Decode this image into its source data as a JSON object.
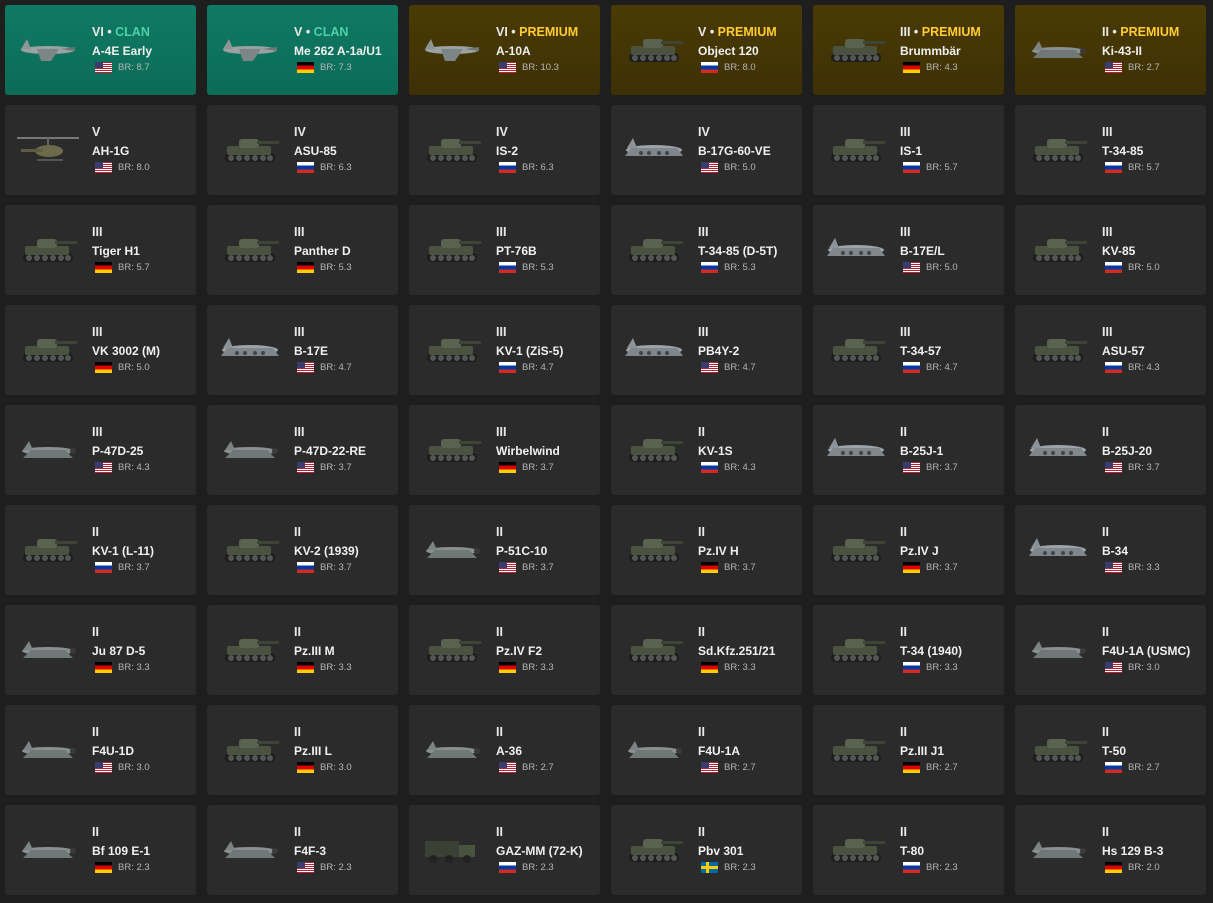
{
  "br_prefix": "BR: ",
  "tag_separator": " • ",
  "cards": [
    {
      "tier": "VI",
      "tag": "CLAN",
      "style": "clan",
      "name": "A-4E Early",
      "nation": "usa",
      "br": "8.7",
      "kind": "jet"
    },
    {
      "tier": "V",
      "tag": "CLAN",
      "style": "clan",
      "name": "Me 262 A-1a/U1",
      "nation": "ger",
      "br": "7.3",
      "kind": "jet"
    },
    {
      "tier": "VI",
      "tag": "PREMIUM",
      "style": "premium",
      "name": "A-10A",
      "nation": "usa",
      "br": "10.3",
      "kind": "jet"
    },
    {
      "tier": "V",
      "tag": "PREMIUM",
      "style": "premium",
      "name": "Object 120",
      "nation": "ussr",
      "br": "8.0",
      "kind": "tank"
    },
    {
      "tier": "III",
      "tag": "PREMIUM",
      "style": "premium",
      "name": "Brummbär",
      "nation": "ger",
      "br": "4.3",
      "kind": "tank"
    },
    {
      "tier": "II",
      "tag": "PREMIUM",
      "style": "premium",
      "name": "Ki-43-II",
      "nation": "usa",
      "br": "2.7",
      "kind": "plane"
    },
    {
      "tier": "V",
      "tag": "",
      "style": "normal",
      "name": "AH-1G",
      "nation": "usa",
      "br": "8.0",
      "kind": "heli"
    },
    {
      "tier": "IV",
      "tag": "",
      "style": "normal",
      "name": "ASU-85",
      "nation": "ussr",
      "br": "6.3",
      "kind": "tank"
    },
    {
      "tier": "IV",
      "tag": "",
      "style": "normal",
      "name": "IS-2",
      "nation": "ussr",
      "br": "6.3",
      "kind": "tank"
    },
    {
      "tier": "IV",
      "tag": "",
      "style": "normal",
      "name": "B-17G-60-VE",
      "nation": "usa",
      "br": "5.0",
      "kind": "bomber"
    },
    {
      "tier": "III",
      "tag": "",
      "style": "normal",
      "name": "IS-1",
      "nation": "ussr",
      "br": "5.7",
      "kind": "tank"
    },
    {
      "tier": "III",
      "tag": "",
      "style": "normal",
      "name": "T-34-85",
      "nation": "ussr",
      "br": "5.7",
      "kind": "tank"
    },
    {
      "tier": "III",
      "tag": "",
      "style": "normal",
      "name": "Tiger H1",
      "nation": "ger",
      "br": "5.7",
      "kind": "tank"
    },
    {
      "tier": "III",
      "tag": "",
      "style": "normal",
      "name": "Panther D",
      "nation": "ger",
      "br": "5.3",
      "kind": "tank"
    },
    {
      "tier": "III",
      "tag": "",
      "style": "normal",
      "name": "PT-76B",
      "nation": "ussr",
      "br": "5.3",
      "kind": "tank"
    },
    {
      "tier": "III",
      "tag": "",
      "style": "normal",
      "name": "T-34-85 (D-5T)",
      "nation": "ussr",
      "br": "5.3",
      "kind": "tank"
    },
    {
      "tier": "III",
      "tag": "",
      "style": "normal",
      "name": "B-17E/L",
      "nation": "usa",
      "br": "5.0",
      "kind": "bomber"
    },
    {
      "tier": "III",
      "tag": "",
      "style": "normal",
      "name": "KV-85",
      "nation": "ussr",
      "br": "5.0",
      "kind": "tank"
    },
    {
      "tier": "III",
      "tag": "",
      "style": "normal",
      "name": "VK 3002 (M)",
      "nation": "ger",
      "br": "5.0",
      "kind": "tank"
    },
    {
      "tier": "III",
      "tag": "",
      "style": "normal",
      "name": "B-17E",
      "nation": "usa",
      "br": "4.7",
      "kind": "bomber"
    },
    {
      "tier": "III",
      "tag": "",
      "style": "normal",
      "name": "KV-1 (ZiS-5)",
      "nation": "ussr",
      "br": "4.7",
      "kind": "tank"
    },
    {
      "tier": "III",
      "tag": "",
      "style": "normal",
      "name": "PB4Y-2",
      "nation": "usa",
      "br": "4.7",
      "kind": "bomber"
    },
    {
      "tier": "III",
      "tag": "",
      "style": "normal",
      "name": "T-34-57",
      "nation": "ussr",
      "br": "4.7",
      "kind": "tank"
    },
    {
      "tier": "III",
      "tag": "",
      "style": "normal",
      "name": "ASU-57",
      "nation": "ussr",
      "br": "4.3",
      "kind": "tank"
    },
    {
      "tier": "III",
      "tag": "",
      "style": "normal",
      "name": "P-47D-25",
      "nation": "usa",
      "br": "4.3",
      "kind": "plane"
    },
    {
      "tier": "III",
      "tag": "",
      "style": "normal",
      "name": "P-47D-22-RE",
      "nation": "usa",
      "br": "3.7",
      "kind": "plane"
    },
    {
      "tier": "III",
      "tag": "",
      "style": "normal",
      "name": "Wirbelwind",
      "nation": "ger",
      "br": "3.7",
      "kind": "tank"
    },
    {
      "tier": "II",
      "tag": "",
      "style": "normal",
      "name": "KV-1S",
      "nation": "ussr",
      "br": "4.3",
      "kind": "tank"
    },
    {
      "tier": "II",
      "tag": "",
      "style": "normal",
      "name": "B-25J-1",
      "nation": "usa",
      "br": "3.7",
      "kind": "bomber"
    },
    {
      "tier": "II",
      "tag": "",
      "style": "normal",
      "name": "B-25J-20",
      "nation": "usa",
      "br": "3.7",
      "kind": "bomber"
    },
    {
      "tier": "II",
      "tag": "",
      "style": "normal",
      "name": "KV-1 (L-11)",
      "nation": "ussr",
      "br": "3.7",
      "kind": "tank"
    },
    {
      "tier": "II",
      "tag": "",
      "style": "normal",
      "name": "KV-2 (1939)",
      "nation": "ussr",
      "br": "3.7",
      "kind": "tank"
    },
    {
      "tier": "II",
      "tag": "",
      "style": "normal",
      "name": "P-51C-10",
      "nation": "usa",
      "br": "3.7",
      "kind": "plane"
    },
    {
      "tier": "II",
      "tag": "",
      "style": "normal",
      "name": "Pz.IV H",
      "nation": "ger",
      "br": "3.7",
      "kind": "tank"
    },
    {
      "tier": "II",
      "tag": "",
      "style": "normal",
      "name": "Pz.IV J",
      "nation": "ger",
      "br": "3.7",
      "kind": "tank"
    },
    {
      "tier": "II",
      "tag": "",
      "style": "normal",
      "name": "B-34",
      "nation": "usa",
      "br": "3.3",
      "kind": "bomber"
    },
    {
      "tier": "II",
      "tag": "",
      "style": "normal",
      "name": "Ju 87 D-5",
      "nation": "ger",
      "br": "3.3",
      "kind": "plane"
    },
    {
      "tier": "II",
      "tag": "",
      "style": "normal",
      "name": "Pz.III M",
      "nation": "ger",
      "br": "3.3",
      "kind": "tank"
    },
    {
      "tier": "II",
      "tag": "",
      "style": "normal",
      "name": "Pz.IV F2",
      "nation": "ger",
      "br": "3.3",
      "kind": "tank"
    },
    {
      "tier": "II",
      "tag": "",
      "style": "normal",
      "name": "Sd.Kfz.251/21",
      "nation": "ger",
      "br": "3.3",
      "kind": "tank"
    },
    {
      "tier": "II",
      "tag": "",
      "style": "normal",
      "name": "T-34 (1940)",
      "nation": "ussr",
      "br": "3.3",
      "kind": "tank"
    },
    {
      "tier": "II",
      "tag": "",
      "style": "normal",
      "name": "F4U-1A (USMC)",
      "nation": "usa",
      "br": "3.0",
      "kind": "plane"
    },
    {
      "tier": "II",
      "tag": "",
      "style": "normal",
      "name": "F4U-1D",
      "nation": "usa",
      "br": "3.0",
      "kind": "plane"
    },
    {
      "tier": "II",
      "tag": "",
      "style": "normal",
      "name": "Pz.III L",
      "nation": "ger",
      "br": "3.0",
      "kind": "tank"
    },
    {
      "tier": "II",
      "tag": "",
      "style": "normal",
      "name": "A-36",
      "nation": "usa",
      "br": "2.7",
      "kind": "plane"
    },
    {
      "tier": "II",
      "tag": "",
      "style": "normal",
      "name": "F4U-1A",
      "nation": "usa",
      "br": "2.7",
      "kind": "plane"
    },
    {
      "tier": "II",
      "tag": "",
      "style": "normal",
      "name": "Pz.III J1",
      "nation": "ger",
      "br": "2.7",
      "kind": "tank"
    },
    {
      "tier": "II",
      "tag": "",
      "style": "normal",
      "name": "T-50",
      "nation": "ussr",
      "br": "2.7",
      "kind": "tank"
    },
    {
      "tier": "II",
      "tag": "",
      "style": "normal",
      "name": "Bf 109 E-1",
      "nation": "ger",
      "br": "2.3",
      "kind": "plane"
    },
    {
      "tier": "II",
      "tag": "",
      "style": "normal",
      "name": "F4F-3",
      "nation": "usa",
      "br": "2.3",
      "kind": "plane"
    },
    {
      "tier": "II",
      "tag": "",
      "style": "normal",
      "name": "GAZ-MM (72-K)",
      "nation": "ussr",
      "br": "2.3",
      "kind": "truck"
    },
    {
      "tier": "II",
      "tag": "",
      "style": "normal",
      "name": "Pbv 301",
      "nation": "swe",
      "br": "2.3",
      "kind": "tank"
    },
    {
      "tier": "II",
      "tag": "",
      "style": "normal",
      "name": "T-80",
      "nation": "ussr",
      "br": "2.3",
      "kind": "tank"
    },
    {
      "tier": "II",
      "tag": "",
      "style": "normal",
      "name": "Hs 129 B-3",
      "nation": "ger",
      "br": "2.0",
      "kind": "plane"
    }
  ]
}
